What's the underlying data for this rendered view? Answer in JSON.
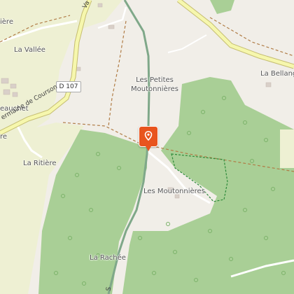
{
  "map": {
    "road_shield": "D 107",
    "places": [
      {
        "id": "la-vallee",
        "label": "La Vallée"
      },
      {
        "id": "petites-moutonnieres",
        "line1": "Les Petites",
        "line2": "Moutonnières"
      },
      {
        "id": "la-bellang",
        "label": "La Bellang"
      },
      {
        "id": "la-ritiere",
        "label": "La Ritière"
      },
      {
        "id": "les-moutonnieres",
        "label": "Les Moutonnières"
      },
      {
        "id": "la-rachee",
        "label": "La Rachée"
      },
      {
        "id": "beauchet",
        "label": "eauchet"
      },
      {
        "id": "iere-top",
        "label": "ière"
      },
      {
        "id": "re-left",
        "label": "re"
      }
    ],
    "road_labels": {
      "germaine": "ermaine de Courson",
      "val_top": "Va",
      "s_bottom": "S"
    },
    "marker_icon": "location-pin-icon",
    "colors": {
      "background": "#f1eee8",
      "forest": "#a9cf96",
      "farmland": "#eef0d3",
      "road_main": "#f6f7ad",
      "road_outline": "#c5bd71",
      "track": "#b07c46",
      "river": "#7fa889",
      "marker": "#e8541e"
    }
  }
}
